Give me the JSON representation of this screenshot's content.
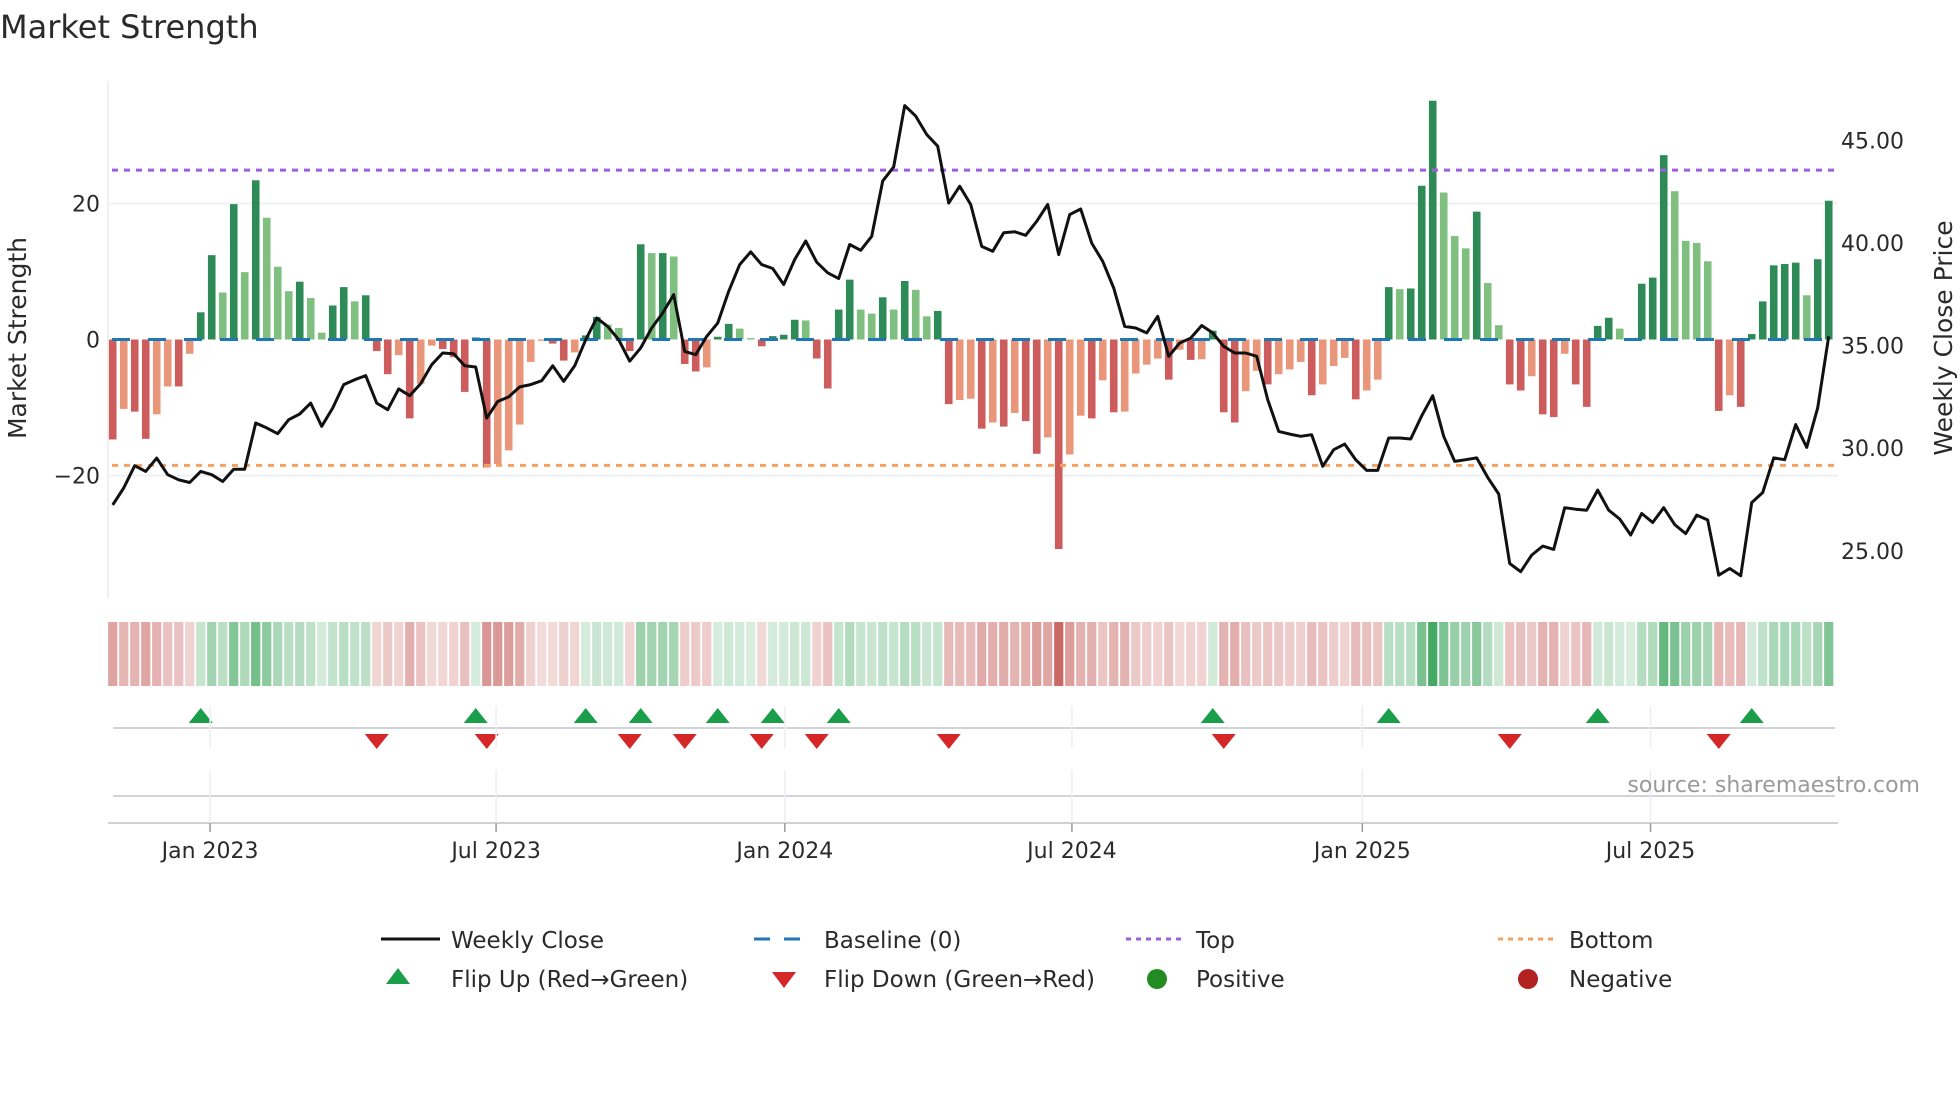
{
  "chart_data": {
    "type": "bar",
    "title": "Market Strength",
    "ylabel": "Market Strength",
    "y2label": "Weekly Close Price",
    "ylim": [
      -38,
      38
    ],
    "y2lim": [
      22.7,
      47.9
    ],
    "y_ticks": [
      {
        "value": 20,
        "label": "20"
      },
      {
        "value": 0,
        "label": "0"
      },
      {
        "value": -20,
        "label": "−20"
      }
    ],
    "y2_ticks": [
      {
        "value": 45,
        "label": "45.00"
      },
      {
        "value": 40,
        "label": "40.00"
      },
      {
        "value": 35,
        "label": "35.00"
      },
      {
        "value": 30,
        "label": "30.00"
      },
      {
        "value": 25,
        "label": "25.00"
      }
    ],
    "x_ticks": [
      {
        "at": 8.85,
        "label": "Jan 2023"
      },
      {
        "at": 34.85,
        "label": "Jul 2023"
      },
      {
        "at": 61.1,
        "label": "Jan 2024"
      },
      {
        "at": 87.2,
        "label": "Jul 2024"
      },
      {
        "at": 113.6,
        "label": "Jan 2025"
      },
      {
        "at": 139.8,
        "label": "Jul 2025"
      }
    ],
    "x_unit": "week index",
    "top_level": 24.9,
    "bottom_level": -18.5,
    "baseline": 0,
    "series": [
      {
        "name": "Market Strength",
        "type": "bar",
        "values": [
          -14.7,
          -10.2,
          -10.6,
          -14.6,
          -11.0,
          -6.9,
          -6.9,
          -2.1,
          4.0,
          12.4,
          6.9,
          19.9,
          9.9,
          23.4,
          17.9,
          10.7,
          7.1,
          8.5,
          6.1,
          1.0,
          5.0,
          7.7,
          5.6,
          6.5,
          -1.7,
          -5.1,
          -2.3,
          -11.6,
          -6.5,
          -0.9,
          -1.4,
          -2.6,
          -7.7,
          0.3,
          -18.8,
          -18.3,
          -16.3,
          -12.5,
          -3.3,
          -0.2,
          -0.6,
          -3.1,
          -1.9,
          0.6,
          3.3,
          2.2,
          1.7,
          -1.7,
          14.0,
          12.7,
          12.7,
          12.2,
          -3.6,
          -4.7,
          -4.1,
          0.4,
          2.3,
          1.6,
          0.2,
          -1.0,
          0.5,
          0.7,
          2.9,
          2.8,
          -2.8,
          -7.2,
          4.4,
          8.8,
          4.4,
          3.8,
          6.2,
          4.4,
          8.6,
          7.3,
          3.4,
          4.2,
          -9.5,
          -8.9,
          -8.7,
          -13.1,
          -12.2,
          -12.8,
          -10.8,
          -12.0,
          -16.8,
          -14.4,
          -30.8,
          -16.9,
          -11.2,
          -11.6,
          -6.0,
          -10.7,
          -10.6,
          -5.0,
          -3.7,
          -2.8,
          -5.9,
          -1.5,
          -3.0,
          -2.9,
          1.3,
          -10.7,
          -12.2,
          -7.6,
          -4.6,
          -6.6,
          -5.1,
          -4.4,
          -3.3,
          -8.2,
          -6.6,
          -3.9,
          -2.7,
          -8.8,
          -7.5,
          -5.9,
          7.7,
          7.4,
          7.5,
          22.6,
          35.1,
          21.6,
          15.2,
          13.4,
          18.8,
          8.3,
          2.1,
          -6.6,
          -7.5,
          -5.4,
          -11.0,
          -11.4,
          -2.1,
          -6.6,
          -9.9,
          2.0,
          3.2,
          1.6,
          0.1,
          8.2,
          9.1,
          27.1,
          21.8,
          14.5,
          14.2,
          11.5,
          -10.5,
          -8.2,
          -9.9,
          0.8,
          5.6,
          10.9,
          11.1,
          11.3,
          6.5,
          11.8,
          20.4
        ]
      },
      {
        "name": "Weekly Close",
        "type": "line",
        "axis": "right",
        "values": [
          27.24,
          28.06,
          29.15,
          28.87,
          29.52,
          28.71,
          28.46,
          28.33,
          28.87,
          28.71,
          28.38,
          28.98,
          28.98,
          31.23,
          30.99,
          30.71,
          31.39,
          31.67,
          32.2,
          31.07,
          31.96,
          33.1,
          33.34,
          33.54,
          32.2,
          31.88,
          32.89,
          32.56,
          33.15,
          34.07,
          34.64,
          34.61,
          34.02,
          33.96,
          31.47,
          32.28,
          32.5,
          32.99,
          33.1,
          33.29,
          34.02,
          33.26,
          34.02,
          35.29,
          36.35,
          35.94,
          35.29,
          34.24,
          34.89,
          35.86,
          36.59,
          37.49,
          34.72,
          34.56,
          35.45,
          36.1,
          37.65,
          38.95,
          39.57,
          38.95,
          38.76,
          37.98,
          39.2,
          40.1,
          39.07,
          38.55,
          38.27,
          39.93,
          39.65,
          40.33,
          43.02,
          43.72,
          46.7,
          46.19,
          45.29,
          44.72,
          41.95,
          42.77,
          41.88,
          39.84,
          39.6,
          40.5,
          40.55,
          40.38,
          41.06,
          41.88,
          39.44,
          41.39,
          41.66,
          40.0,
          39.11,
          37.81,
          35.94,
          35.86,
          35.62,
          36.43,
          34.48,
          35.13,
          35.37,
          35.98,
          35.62,
          34.97,
          34.64,
          34.64,
          34.48,
          32.37,
          30.82,
          30.69,
          30.58,
          30.66,
          29.12,
          29.93,
          30.2,
          29.44,
          28.92,
          28.92,
          30.5,
          30.5,
          30.45,
          31.58,
          32.56,
          30.58,
          29.36,
          29.44,
          29.53,
          28.58,
          27.77,
          24.38,
          23.98,
          24.79,
          25.23,
          25.07,
          27.1,
          27.03,
          26.98,
          27.96,
          26.98,
          26.55,
          25.77,
          26.82,
          26.38,
          27.1,
          26.28,
          25.84,
          26.74,
          26.5,
          23.81,
          24.14,
          23.78,
          27.35,
          27.84,
          29.53,
          29.44,
          31.15,
          30.04,
          31.97,
          35.45
        ]
      }
    ],
    "legend": [
      {
        "label": "Weekly Close",
        "icon": "solid-line",
        "color": "#111111"
      },
      {
        "label": "Baseline (0)",
        "icon": "dashed-line",
        "color": "#1f77b4"
      },
      {
        "label": "Top",
        "icon": "dotted-line",
        "color": "#9d5fe0"
      },
      {
        "label": "Bottom",
        "icon": "dotted-line",
        "color": "#f4a261"
      },
      {
        "label": "Flip Up (Red→Green)",
        "icon": "triangle-up",
        "color": "#1a9e4a"
      },
      {
        "label": "Flip Down (Green→Red)",
        "icon": "triangle-down",
        "color": "#d62728"
      },
      {
        "label": "Positive",
        "icon": "circle",
        "color": "#228b22"
      },
      {
        "label": "Negative",
        "icon": "circle",
        "color": "#b22222"
      }
    ],
    "legend_position": "bottom",
    "grid": true,
    "colors": {
      "pos_strong": "#2e8b57",
      "pos_weak": "#7fbf7f",
      "neg_strong": "#cd5c5c",
      "neg_weak": "#e9967a",
      "flip_up": "#1a9e4a",
      "flip_down": "#d62728"
    }
  },
  "source": "source: sharemaestro.com"
}
